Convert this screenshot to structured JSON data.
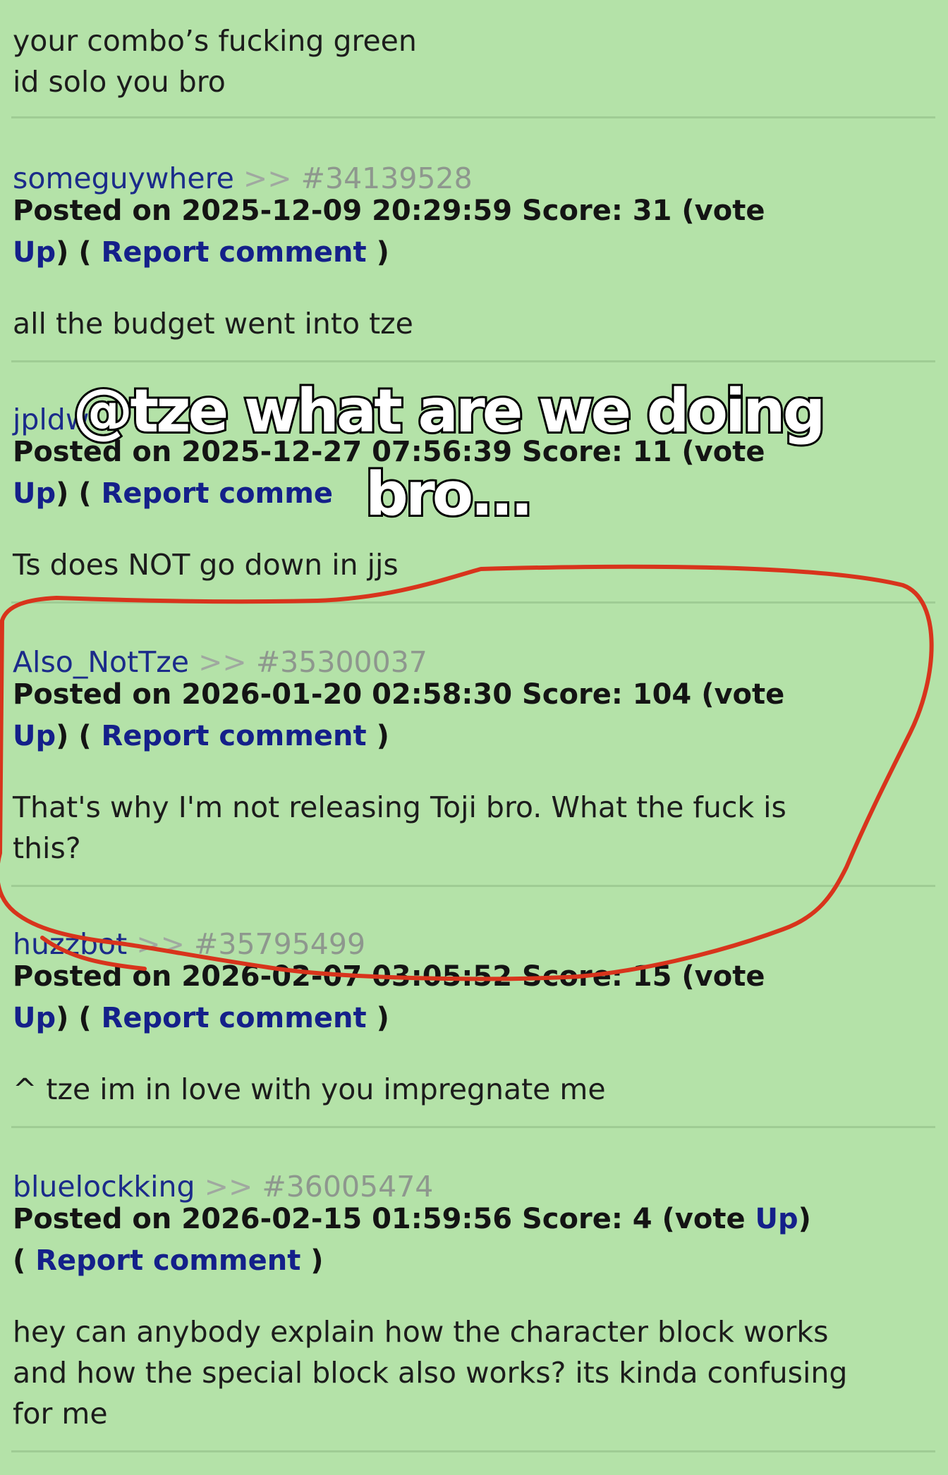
{
  "top_comment": {
    "lines": [
      "your combo’s fucking green",
      "id solo you bro"
    ]
  },
  "comments": [
    {
      "username": "someguywhere",
      "separator": ">>",
      "comment_id": "#34139528",
      "meta_lines": [
        [
          {
            "text": "Posted on 2025-12-09 20:29:59 Score: 31 (vote",
            "link": false
          }
        ],
        [
          {
            "text": "Up",
            "link": true
          },
          {
            "text": ") ( ",
            "link": false
          },
          {
            "text": "Report comment",
            "link": true
          },
          {
            "text": " )",
            "link": false
          }
        ]
      ],
      "body_lines": [
        "all the budget went into tze"
      ]
    },
    {
      "username": "jpldw",
      "separator": "",
      "comment_id": "",
      "meta_lines": [
        [
          {
            "text": "Posted on 2025-12-27 07:56:39 Score: 11 (vote",
            "link": false
          }
        ],
        [
          {
            "text": "Up",
            "link": true
          },
          {
            "text": ") ( ",
            "link": false
          },
          {
            "text": "Report comme",
            "link": true
          }
        ]
      ],
      "body_lines": [
        "Ts does NOT go down in jjs"
      ]
    },
    {
      "username": "Also_NotTze",
      "separator": ">>",
      "comment_id": "#35300037",
      "meta_lines": [
        [
          {
            "text": "Posted on 2026-01-20 02:58:30 Score: 104 (vote",
            "link": false
          }
        ],
        [
          {
            "text": "Up",
            "link": true
          },
          {
            "text": ") ( ",
            "link": false
          },
          {
            "text": "Report comment",
            "link": true
          },
          {
            "text": " )",
            "link": false
          }
        ]
      ],
      "body_lines": [
        "That's why I'm not releasing Toji bro. What the fuck is",
        "this?"
      ]
    },
    {
      "username": "huzzbot",
      "separator": ">>",
      "comment_id": "#35795499",
      "meta_lines": [
        [
          {
            "text": "Posted on 2026-02-07 03:05:52 Score: 15 (vote",
            "link": false
          }
        ],
        [
          {
            "text": "Up",
            "link": true
          },
          {
            "text": ") ( ",
            "link": false
          },
          {
            "text": "Report comment",
            "link": true
          },
          {
            "text": " )",
            "link": false
          }
        ]
      ],
      "body_lines": [
        "^ tze im in love with you impregnate me"
      ]
    },
    {
      "username": "bluelockking",
      "separator": ">>",
      "comment_id": "#36005474",
      "meta_lines": [
        [
          {
            "text": "Posted on 2026-02-15 01:59:56 Score: 4 (vote ",
            "link": false
          },
          {
            "text": "Up",
            "link": true
          },
          {
            "text": ")",
            "link": false
          }
        ],
        [
          {
            "text": "( ",
            "link": false
          },
          {
            "text": "Report comment",
            "link": true
          },
          {
            "text": " )",
            "link": false
          }
        ]
      ],
      "body_lines": [
        "hey can anybody explain how the character block works",
        "and how the special block also works? its kinda confusing",
        "for me"
      ]
    }
  ],
  "overlay_caption": [
    "@tze what are we doing",
    "bro..."
  ],
  "colors": {
    "background": "#b4e2a8",
    "username": "#1b2b8a",
    "link": "#14208a",
    "comment_id": "#8e978e",
    "annotation_stroke": "#d8341c"
  }
}
